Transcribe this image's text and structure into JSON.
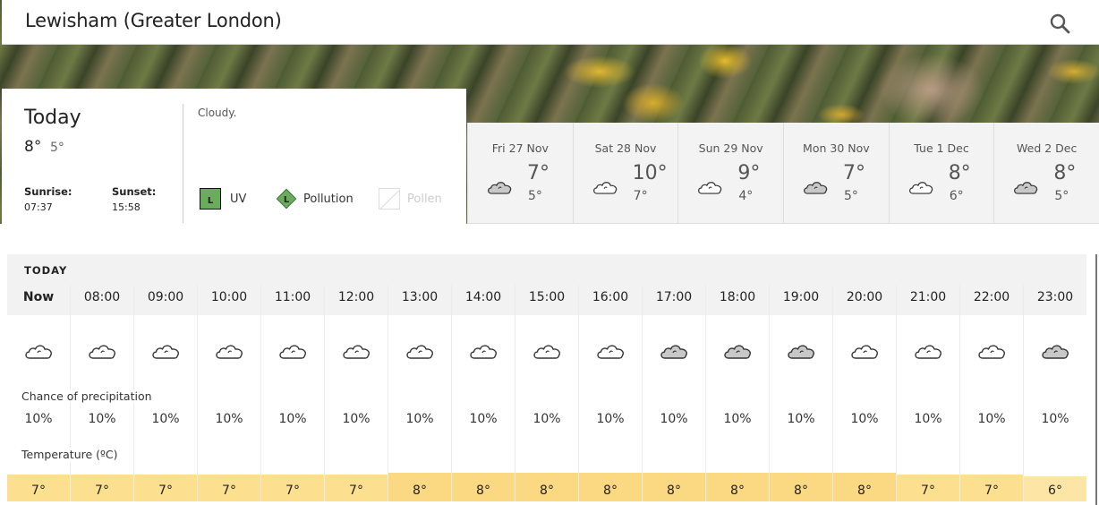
{
  "header": {
    "location": "Lewisham (Greater London)",
    "search_icon": "search-icon"
  },
  "today": {
    "title": "Today",
    "high": "8°",
    "low": "5°",
    "summary": "Cloudy.",
    "sunrise_label": "Sunrise:",
    "sunrise": "07:37",
    "sunset_label": "Sunset:",
    "sunset": "15:58",
    "indicators": [
      {
        "name": "UV",
        "level": "L",
        "icon": "uv-square-icon",
        "color": "#6aab5e",
        "active": true
      },
      {
        "name": "Pollution",
        "level": "L",
        "icon": "pollution-diamond-icon",
        "color": "#6aab5e",
        "active": true
      },
      {
        "name": "Pollen",
        "level": "",
        "icon": "pollen-empty-icon",
        "active": false
      }
    ]
  },
  "forecast": [
    {
      "day": "Fri 27 Nov",
      "high": "7°",
      "low": "5°",
      "icon": "grey-cloud"
    },
    {
      "day": "Sat 28 Nov",
      "high": "10°",
      "low": "7°",
      "icon": "white-cloud"
    },
    {
      "day": "Sun 29 Nov",
      "high": "9°",
      "low": "4°",
      "icon": "white-cloud"
    },
    {
      "day": "Mon 30 Nov",
      "high": "7°",
      "low": "5°",
      "icon": "grey-cloud"
    },
    {
      "day": "Tue 1 Dec",
      "high": "8°",
      "low": "6°",
      "icon": "white-cloud"
    },
    {
      "day": "Wed 2 Dec",
      "high": "8°",
      "low": "5°",
      "icon": "grey-cloud"
    }
  ],
  "hourly": {
    "section_label": "TODAY",
    "precip_label": "Chance of precipitation",
    "temp_label": "Temperature (ºC)",
    "hours": [
      {
        "time": "Now",
        "icon": "white-cloud",
        "precip": "10%",
        "temp": "7°",
        "temp_value": 7
      },
      {
        "time": "08:00",
        "icon": "white-cloud",
        "precip": "10%",
        "temp": "7°",
        "temp_value": 7
      },
      {
        "time": "09:00",
        "icon": "white-cloud",
        "precip": "10%",
        "temp": "7°",
        "temp_value": 7
      },
      {
        "time": "10:00",
        "icon": "white-cloud",
        "precip": "10%",
        "temp": "7°",
        "temp_value": 7
      },
      {
        "time": "11:00",
        "icon": "white-cloud",
        "precip": "10%",
        "temp": "7°",
        "temp_value": 7
      },
      {
        "time": "12:00",
        "icon": "white-cloud",
        "precip": "10%",
        "temp": "7°",
        "temp_value": 7
      },
      {
        "time": "13:00",
        "icon": "white-cloud",
        "precip": "10%",
        "temp": "8°",
        "temp_value": 8
      },
      {
        "time": "14:00",
        "icon": "white-cloud",
        "precip": "10%",
        "temp": "8°",
        "temp_value": 8
      },
      {
        "time": "15:00",
        "icon": "white-cloud",
        "precip": "10%",
        "temp": "8°",
        "temp_value": 8
      },
      {
        "time": "16:00",
        "icon": "white-cloud",
        "precip": "10%",
        "temp": "8°",
        "temp_value": 8
      },
      {
        "time": "17:00",
        "icon": "grey-cloud",
        "precip": "10%",
        "temp": "8°",
        "temp_value": 8
      },
      {
        "time": "18:00",
        "icon": "grey-cloud",
        "precip": "10%",
        "temp": "8°",
        "temp_value": 8
      },
      {
        "time": "19:00",
        "icon": "grey-cloud",
        "precip": "10%",
        "temp": "8°",
        "temp_value": 8
      },
      {
        "time": "20:00",
        "icon": "white-cloud",
        "precip": "10%",
        "temp": "8°",
        "temp_value": 8
      },
      {
        "time": "21:00",
        "icon": "white-cloud",
        "precip": "10%",
        "temp": "7°",
        "temp_value": 7
      },
      {
        "time": "22:00",
        "icon": "white-cloud",
        "precip": "10%",
        "temp": "7°",
        "temp_value": 7
      },
      {
        "time": "23:00",
        "icon": "grey-cloud",
        "precip": "10%",
        "temp": "6°",
        "temp_value": 6
      }
    ]
  },
  "colors": {
    "temp_8": "#fbd983",
    "temp_7": "#fde08f",
    "temp_6": "#fde6a5",
    "grey_cloud_fill": "#c8c8c8",
    "white_cloud_fill": "#ffffff"
  }
}
